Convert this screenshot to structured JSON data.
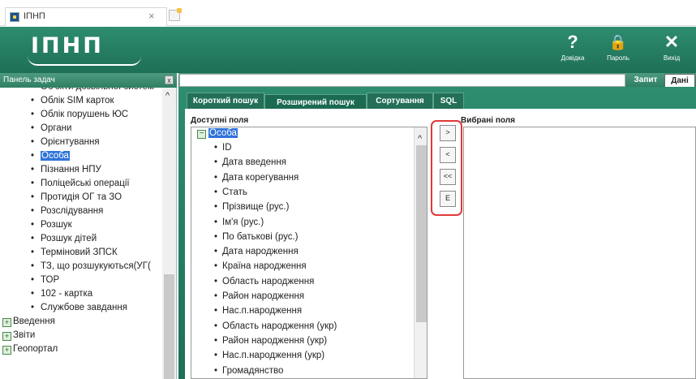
{
  "browser": {
    "tab_title": "ІПНП",
    "close_glyph": "×"
  },
  "header": {
    "logo": "ІПНП",
    "buttons": [
      {
        "icon": "?",
        "label": "Довідка"
      },
      {
        "icon": "🔒",
        "label": "Пароль"
      },
      {
        "icon": "✕",
        "label": "Вихід"
      }
    ]
  },
  "left_panel": {
    "title": "Панель задач",
    "close_glyph": "x",
    "items": [
      {
        "label": "Об'єкти дозвільної систем",
        "type": "leaf"
      },
      {
        "label": "Облік SIM карток",
        "type": "leaf"
      },
      {
        "label": "Облік порушень ЮС",
        "type": "leaf"
      },
      {
        "label": "Органи",
        "type": "leaf"
      },
      {
        "label": "Орієнтування",
        "type": "leaf"
      },
      {
        "label": "Особа",
        "type": "leaf",
        "selected": true
      },
      {
        "label": "Пізнання НПУ",
        "type": "leaf"
      },
      {
        "label": "Поліцейські операції",
        "type": "leaf"
      },
      {
        "label": "Протидія ОГ та ЗО",
        "type": "leaf"
      },
      {
        "label": "Розслідування",
        "type": "leaf"
      },
      {
        "label": "Розшук",
        "type": "leaf"
      },
      {
        "label": "Розшук дітей",
        "type": "leaf"
      },
      {
        "label": "Терміновий ЗПСК",
        "type": "leaf"
      },
      {
        "label": "ТЗ, що розшукуються(УГ(",
        "type": "leaf"
      },
      {
        "label": "ТОР",
        "type": "leaf"
      },
      {
        "label": "102 - картка",
        "type": "leaf"
      },
      {
        "label": "Службове завдання",
        "type": "leaf"
      },
      {
        "label": "Введення",
        "type": "group"
      },
      {
        "label": "Звіти",
        "type": "group"
      },
      {
        "label": "Геопортал",
        "type": "group"
      }
    ]
  },
  "query_bar": {
    "value": "",
    "buttons": [
      "Запит",
      "Дані"
    ],
    "active": "Дані"
  },
  "tabs": [
    "Короткий пошук",
    "Розширений пошук",
    "Сортування",
    "SQL"
  ],
  "active_tab": "Розширений пошук",
  "available_fields": {
    "label": "Доступні поля",
    "root": "Особа",
    "items": [
      "ID",
      "Дата введення",
      "Дата корегування",
      "Стать",
      "Прізвище (рус.)",
      "Ім'я (рус.)",
      "По батькові (рус.)",
      "Дата народження",
      "Країна народження",
      "Область народження",
      "Район народження",
      "Нас.п.народження",
      "Область народження (укр)",
      "Район народження (укр)",
      "Нас.п.народження (укр)",
      "Громадянство"
    ]
  },
  "move_buttons": [
    ">",
    "<",
    "<<",
    "E"
  ],
  "selected_fields": {
    "label": "Вибрані поля",
    "items": []
  },
  "colors": {
    "header_green": "#2e8d6f",
    "selection_blue": "#2f73d9",
    "highlight_red": "#e23838"
  }
}
